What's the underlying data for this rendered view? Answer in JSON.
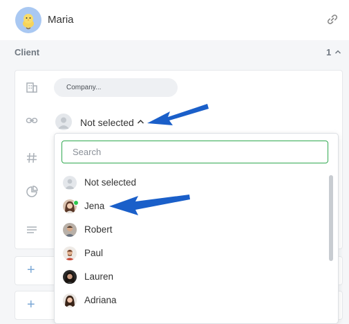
{
  "header": {
    "username": "Maria"
  },
  "section": {
    "title": "Client",
    "count": "1"
  },
  "fields": {
    "company_placeholder": "Company...",
    "selected_value": "Not selected"
  },
  "dropdown": {
    "search_placeholder": "Search",
    "options": [
      {
        "label": "Not selected",
        "avatar": "default-user-icon"
      },
      {
        "label": "Jena",
        "online": true
      },
      {
        "label": "Robert"
      },
      {
        "label": "Paul"
      },
      {
        "label": "Lauren"
      },
      {
        "label": "Adriana"
      }
    ]
  },
  "colors": {
    "accent_green": "#2fa84f",
    "arrow_blue": "#1a5fc9",
    "plus_blue": "#7aa7d6"
  }
}
